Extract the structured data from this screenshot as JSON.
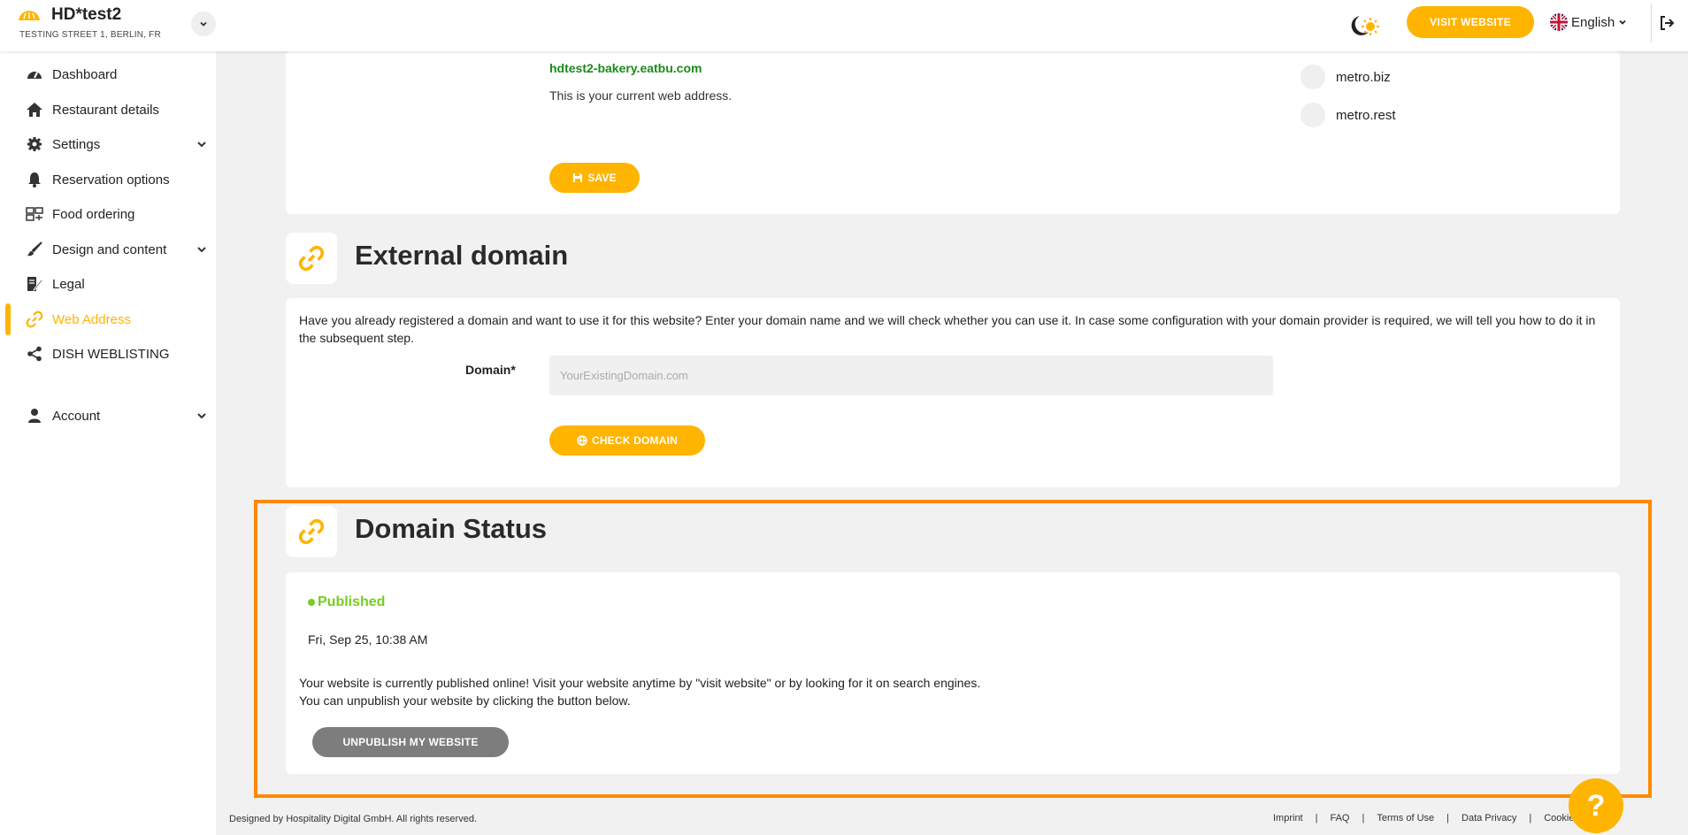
{
  "header": {
    "restaurant_name": "HD*test2",
    "address": "TESTING STREET 1, BERLIN, FR",
    "visit_website": "VISIT WEBSITE",
    "language": "English"
  },
  "sidebar": {
    "items": [
      {
        "label": "Dashboard",
        "icon": "dashboard-icon"
      },
      {
        "label": "Restaurant details",
        "icon": "home-icon"
      },
      {
        "label": "Settings",
        "icon": "gear-icon"
      },
      {
        "label": "Reservation options",
        "icon": "bell-icon"
      },
      {
        "label": "Food ordering",
        "icon": "food-ordering-icon"
      },
      {
        "label": "Design and content",
        "icon": "brush-icon"
      },
      {
        "label": "Legal",
        "icon": "legal-icon"
      },
      {
        "label": "Web Address",
        "icon": "link-icon"
      },
      {
        "label": "DISH WEBLISTING",
        "icon": "share-icon"
      },
      {
        "label": "Account",
        "icon": "user-icon"
      }
    ]
  },
  "web_address": {
    "current_url": "hdtest2-bakery.eatbu.com",
    "current_desc": "This is your current web address.",
    "options": [
      "metro.biz",
      "metro.rest"
    ],
    "save_label": "SAVE"
  },
  "external_domain": {
    "title": "External domain",
    "description": "Have you already registered a domain and want to use it for this website? Enter your domain name and we will check whether you can use it. In case some configuration with your domain provider is required, we will tell you how to do it in the subsequent step.",
    "domain_label": "Domain*",
    "domain_placeholder": "YourExistingDomain.com",
    "domain_value": "",
    "check_label": "CHECK DOMAIN"
  },
  "domain_status": {
    "title": "Domain Status",
    "status": "Published",
    "date": "Fri, Sep 25, 10:38 AM",
    "message_line1": "Your website is currently published online! Visit your website anytime by \"visit website\" or by looking for it on search engines.",
    "message_line2": "You can unpublish your website by clicking the button below.",
    "unpublish_label": "UNPUBLISH MY WEBSITE"
  },
  "footer": {
    "copyright": "Designed by Hospitality Digital GmbH. All rights reserved.",
    "links": [
      "Imprint",
      "FAQ",
      "Terms of Use",
      "Data Privacy",
      "Cookie settings"
    ]
  },
  "help": {
    "label": "?"
  },
  "colors": {
    "accent": "#ffb400",
    "published": "#77cc22",
    "highlight": "#ff8a00",
    "url_green": "#1b8a1b"
  }
}
